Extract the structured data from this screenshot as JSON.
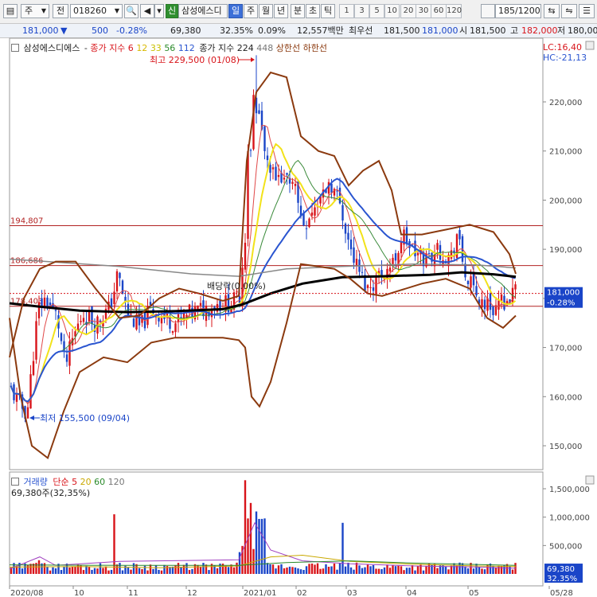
{
  "toolbar": {
    "period_code": "주",
    "jeon_label": "전",
    "stock_code": "018260",
    "credit_badge": "신",
    "stock_name": "삼성에스디",
    "periods": [
      "일",
      "주",
      "월",
      "년",
      "분",
      "초",
      "틱"
    ],
    "active_period": "일",
    "num_tabs": [
      "1",
      "3",
      "5",
      "10",
      "20",
      "30",
      "60",
      "120"
    ],
    "display_count": "185",
    "total_count": "/1200"
  },
  "quote": {
    "price": "181,000",
    "change_arrow": "▼",
    "change": "500",
    "change_pct": "-0.28%",
    "volume": "69,380",
    "volume_ratio": "32.35%",
    "turnover": "0.09%",
    "amount": "12,557백만",
    "best_bid_label": "최우선",
    "best_ask": "181,500",
    "best_bid": "181,000",
    "open_label": "시",
    "open": "181,500",
    "high_label": "고",
    "high": "182,000",
    "low_label": "저",
    "low": "180,00"
  },
  "price_panel": {
    "legend": {
      "name": "삼성에스디에스",
      "ma_label": "종가 지수 6",
      "ma_periods": [
        "12",
        "33",
        "56",
        "112"
      ],
      "ma2_label": "종가 지수 224",
      "ma2_extra": "448",
      "upper_limit": "상한선",
      "lower_limit": "하한선"
    },
    "lc_hc": [
      "LC:16,40",
      "HC:-21,13"
    ],
    "annotations": {
      "high": "최고 229,500 (01/08)",
      "low": "최저 155,500 (09/04)",
      "dividend": "배당락(0.00%)"
    },
    "hlines": [
      "194,807",
      "186,686",
      "178,403"
    ],
    "current_price": "181,000",
    "current_change": "-0.28%"
  },
  "volume_panel": {
    "legend_title": "거래량",
    "legend_ma_label": "단순",
    "legend_ma": [
      "5",
      "20",
      "60",
      "120"
    ],
    "current_volume": "69,380주(32,35%)",
    "current_tag": "69,380",
    "current_pct_tag": "32.35%"
  },
  "colors": {
    "up": "#d8141a",
    "down": "#1a45c8",
    "bollinger": "#8b3a0f",
    "ma_long": "#000000",
    "ma_yellow": "#f2e21a",
    "ma_blue": "#2a55d0",
    "ma_green": "#3a8a3a",
    "ma_gray": "#888888"
  },
  "chart_data": {
    "type": "candlestick",
    "title": "삼성에스디에스",
    "ylim": [
      145000,
      232000
    ],
    "yticks": [
      150000,
      160000,
      170000,
      180000,
      190000,
      200000,
      210000,
      220000
    ],
    "ytick_labels": [
      "150,000",
      "160,000",
      "170,000",
      "180,000",
      "190,000",
      "200,000",
      "210,000",
      "220,000"
    ],
    "xtick_labels": [
      "2020/08",
      "10",
      "11",
      "12",
      "2021/01",
      "02",
      "03",
      "04",
      "05",
      "05/28"
    ],
    "high_point": {
      "value": 229500,
      "date": "01/08"
    },
    "low_point": {
      "value": 155500,
      "date": "09/04"
    },
    "reference_lines": [
      194807,
      186686,
      178403
    ],
    "last_close": 181000,
    "last_change_pct": -0.28,
    "volume": {
      "ylim": [
        0,
        1800000
      ],
      "yticks": [
        500000,
        1000000,
        1500000
      ],
      "ytick_labels": [
        "500,000",
        "1,000,000",
        "1,500,000"
      ],
      "last": 69380
    }
  }
}
